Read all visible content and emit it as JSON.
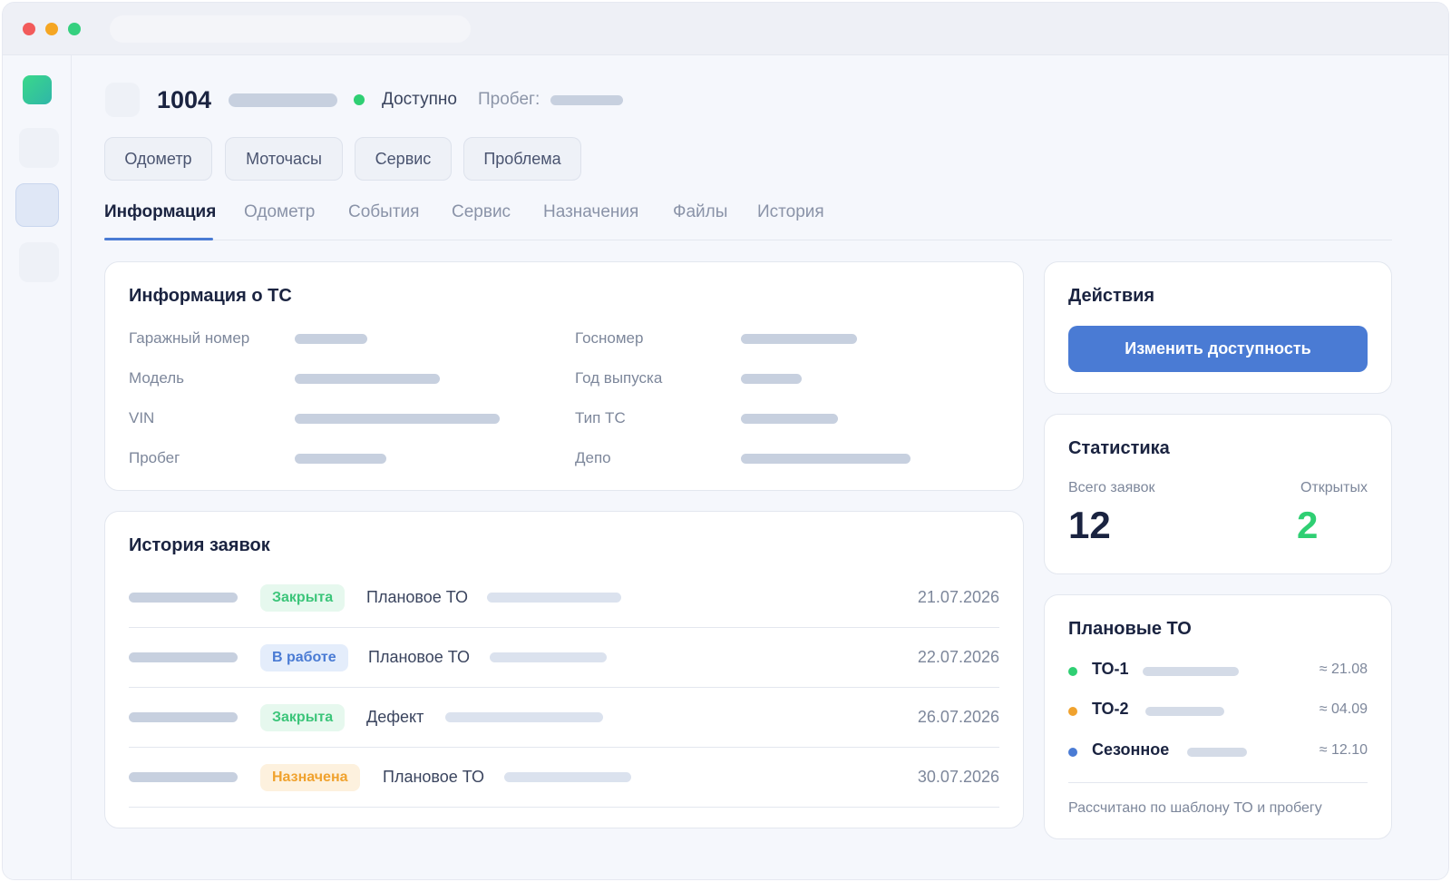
{
  "vehicle": {
    "id": "1004",
    "status": "Доступно",
    "mileage_label": "Пробег:",
    "status_color": "#2fcf73"
  },
  "quick_actions": [
    "Одометр",
    "Моточасы",
    "Сервис",
    "Проблема"
  ],
  "tabs": [
    "Информация",
    "Одометр",
    "События",
    "Сервис",
    "Назначения",
    "Файлы",
    "История"
  ],
  "info_card": {
    "title": "Информация о ТС",
    "fields": [
      {
        "label": "Гаражный номер"
      },
      {
        "label": "Модель"
      },
      {
        "label": "VIN"
      },
      {
        "label": "Пробег"
      },
      {
        "label": "Госномер"
      },
      {
        "label": "Год выпуска"
      },
      {
        "label": "Тип ТС"
      },
      {
        "label": "Депо"
      }
    ]
  },
  "history": {
    "title": "История заявок",
    "rows": [
      {
        "status": "Закрыта",
        "type": "Плановое ТО",
        "date": "21.07.2026"
      },
      {
        "status": "В работе",
        "type": "Плановое ТО",
        "date": "22.07.2026"
      },
      {
        "status": "Закрыта",
        "type": "Дефект",
        "date": "26.07.2026"
      },
      {
        "status": "Назначена",
        "type": "Плановое ТО",
        "date": "30.07.2026"
      }
    ]
  },
  "actions": {
    "title": "Действия",
    "change_availability": "Изменить доступность",
    "button_color": "#4a7bd4"
  },
  "stats": {
    "title": "Статистика",
    "total_label": "Всего заявок",
    "total_value": "12",
    "open_label": "Открытых",
    "open_value": "2"
  },
  "planned": {
    "title": "Плановые ТО",
    "items": [
      {
        "name": "ТО-1",
        "date": "≈ 21.08",
        "color": "#2fcf73"
      },
      {
        "name": "ТО-2",
        "date": "≈ 04.09",
        "color": "#f0a22e"
      },
      {
        "name": "Сезонное",
        "date": "≈ 12.10",
        "color": "#4a7bd4"
      }
    ],
    "note": "Рассчитано по шаблону ТО и пробегу"
  },
  "icons": {
    "window_controls": [
      "close-dot",
      "minimize-dot",
      "maximize-dot"
    ],
    "app_logo": "app-logo-icon",
    "vehicle": "vehicle-icon"
  }
}
